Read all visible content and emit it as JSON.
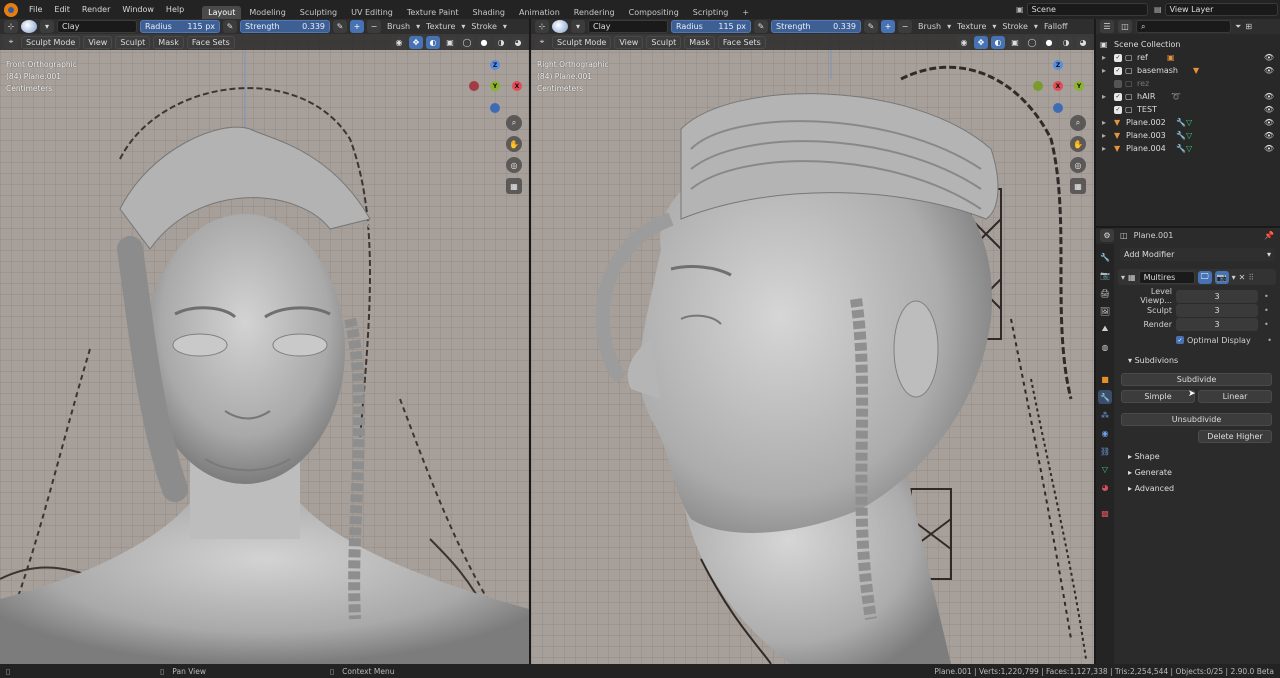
{
  "topbar": {
    "menus": [
      "File",
      "Edit",
      "Render",
      "Window",
      "Help"
    ],
    "workspaces": [
      "Layout",
      "Modeling",
      "Sculpting",
      "UV Editing",
      "Texture Paint",
      "Shading",
      "Animation",
      "Rendering",
      "Compositing",
      "Scripting"
    ],
    "active_workspace": "Layout",
    "add_workspace": "+",
    "scene": "Scene",
    "view_layer": "View Layer"
  },
  "brush_toolbar": {
    "brush_name": "Clay",
    "radius_label": "Radius",
    "radius_value": "115 px",
    "strength_label": "Strength",
    "strength_value": "0.339",
    "plus": "+",
    "minus": "−",
    "brush_menu": "Brush",
    "texture_menu": "Texture",
    "stroke_menu": "Stroke",
    "falloff_menu": "Falloff"
  },
  "viewport_left": {
    "mode": "Sculpt Mode",
    "menus": [
      "View",
      "Sculpt",
      "Mask",
      "Face Sets"
    ],
    "view_name": "Front Orthographic",
    "object_info": "(84) Plane.001",
    "units": "Centimeters"
  },
  "viewport_right": {
    "mode": "Sculpt Mode",
    "menus": [
      "View",
      "Sculpt",
      "Mask",
      "Face Sets"
    ],
    "view_name": "Right Orthographic",
    "object_info": "(84) Plane.001",
    "units": "Centimeters"
  },
  "outliner": {
    "root": "Scene Collection",
    "items": [
      {
        "name": "ref",
        "type": "collection"
      },
      {
        "name": "basemash",
        "type": "collection"
      },
      {
        "name": "rez",
        "type": "collection",
        "excluded": true
      },
      {
        "name": "hAIR",
        "type": "collection"
      },
      {
        "name": "TEST",
        "type": "collection"
      },
      {
        "name": "Plane.002",
        "type": "mesh"
      },
      {
        "name": "Plane.003",
        "type": "mesh"
      },
      {
        "name": "Plane.004",
        "type": "mesh"
      }
    ]
  },
  "properties": {
    "object_name": "Plane.001",
    "add_modifier": "Add Modifier",
    "modifier_name": "Multires",
    "level_viewport_label": "Level Viewp...",
    "level_viewport": "3",
    "sculpt_label": "Sculpt",
    "sculpt": "3",
    "render_label": "Render",
    "render": "3",
    "optimal_display": "Optimal Display",
    "subdivisions_panel": "Subdivions",
    "subdivide": "Subdivide",
    "simple": "Simple",
    "linear": "Linear",
    "unsubdivide": "Unsubdivide",
    "delete_higher": "Delete Higher",
    "shape_panel": "Shape",
    "generate_panel": "Generate",
    "advanced_panel": "Advanced"
  },
  "statusbar": {
    "pan_view": "Pan View",
    "context_menu": "Context Menu",
    "stats": "Plane.001 | Verts:1,220,799 | Faces:1,127,338 | Tris:2,254,544 | Objects:0/25 | 2.90.0 Beta"
  },
  "colors": {
    "accent": "#4772b3",
    "viewport_bg": "#a79f99",
    "ui_bg": "#232323"
  }
}
